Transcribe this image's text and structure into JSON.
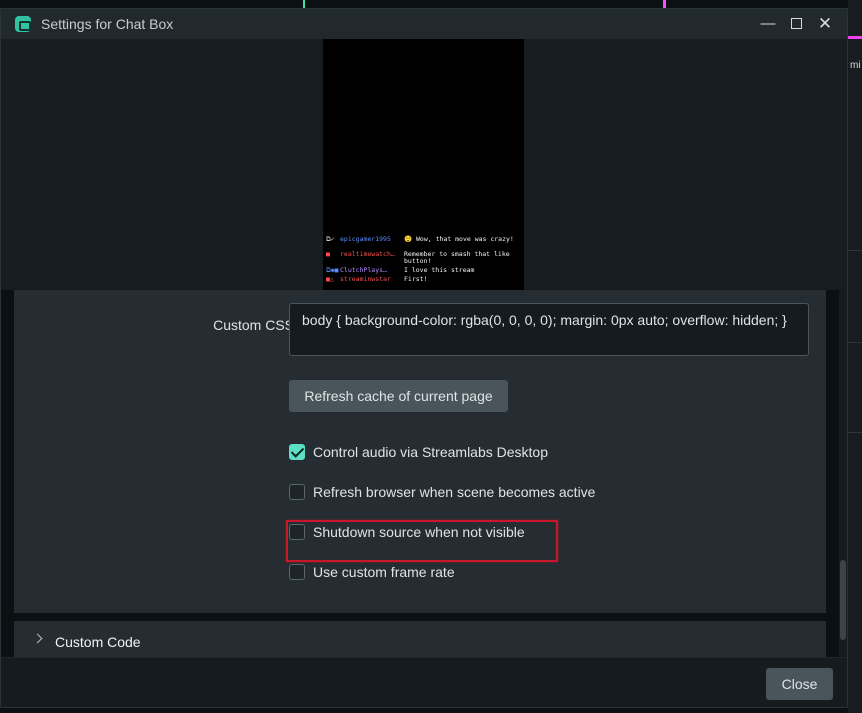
{
  "window": {
    "title": "Settings for Chat Box"
  },
  "preview": {
    "messages": [
      {
        "badges": "⧉✓",
        "user": "epicgamer1995",
        "user_color": "#5b8cff",
        "text": "😲 Wow, that move was crazy!"
      },
      {
        "badges": "■",
        "user": "realtimewatch…",
        "user_color": "#ff4b4b",
        "text": "Remember to smash that like button!"
      },
      {
        "badges": "⧉◆■",
        "user": "ClutchPlays…",
        "user_color": "#b58bff",
        "text": "I love this stream"
      },
      {
        "badges": "■△",
        "user": "streaminwstar",
        "user_color": "#ff4b4b",
        "text": "First!"
      }
    ]
  },
  "settings": {
    "custom_css": {
      "label": "Custom CSS",
      "value": "body { background-color: rgba(0, 0, 0, 0); margin: 0px auto; overflow: hidden; }"
    },
    "refresh_cache_label": "Refresh cache of current page",
    "checkboxes": [
      {
        "label": "Control audio via Streamlabs Desktop",
        "checked": true
      },
      {
        "label": "Refresh browser when scene becomes active",
        "checked": false
      },
      {
        "label": "Shutdown source when not visible",
        "checked": false,
        "highlighted": true
      },
      {
        "label": "Use custom frame rate",
        "checked": false
      }
    ]
  },
  "sections": [
    {
      "title": "Custom Code",
      "expanded": false
    }
  ],
  "footer": {
    "close_label": "Close"
  },
  "background": {
    "right_edge_text": "mi"
  },
  "colors": {
    "accent": "#5be0c6",
    "highlight": "#c8172a",
    "button": "#4a555b"
  }
}
